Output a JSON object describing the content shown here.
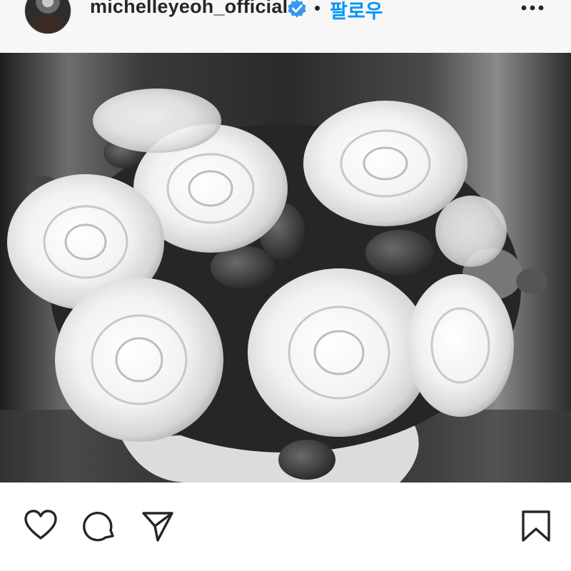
{
  "post": {
    "username": "michelleyeoh_official",
    "separator": "•",
    "follow_label": "팔로우",
    "verified": true,
    "accent_color": "#0095f6",
    "verified_color": "#3897f0"
  },
  "icons": {
    "like": "heart-icon",
    "comment": "comment-icon",
    "share": "send-icon",
    "save": "bookmark-icon",
    "more": "more-options-icon"
  }
}
